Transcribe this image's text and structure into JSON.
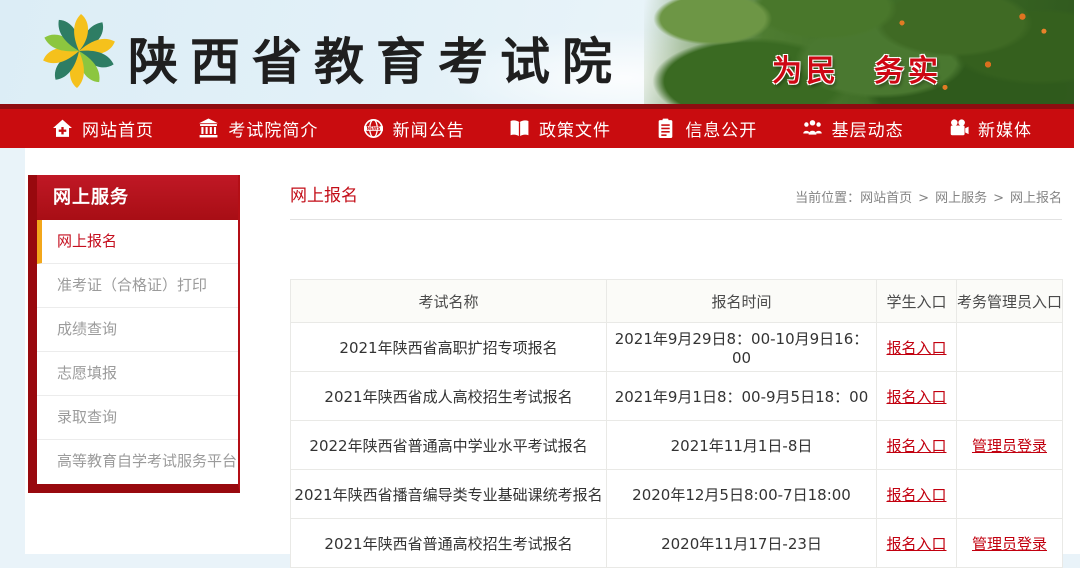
{
  "header": {
    "site_title": "陕西省教育考试院",
    "slogan": "为民　务实",
    "logo": "pinwheel-logo"
  },
  "nav": {
    "items": [
      {
        "label": "网站首页",
        "icon": "home-icon"
      },
      {
        "label": "考试院简介",
        "icon": "building-icon"
      },
      {
        "label": "新闻公告",
        "icon": "news-globe-icon"
      },
      {
        "label": "政策文件",
        "icon": "open-book-icon"
      },
      {
        "label": "信息公开",
        "icon": "document-icon"
      },
      {
        "label": "基层动态",
        "icon": "people-icon"
      },
      {
        "label": "新媒体",
        "icon": "video-camera-icon"
      }
    ]
  },
  "sidebar": {
    "title": "网上服务",
    "items": [
      {
        "label": "网上报名",
        "active": true
      },
      {
        "label": "准考证（合格证）打印",
        "active": false
      },
      {
        "label": "成绩查询",
        "active": false
      },
      {
        "label": "志愿填报",
        "active": false
      },
      {
        "label": "录取查询",
        "active": false
      },
      {
        "label": "高等教育自学考试服务平台",
        "active": false
      }
    ]
  },
  "main": {
    "page_title": "网上报名",
    "breadcrumb": {
      "prefix": "当前位置：",
      "separator": ">",
      "items": [
        "网站首页",
        "网上服务",
        "网上报名"
      ]
    },
    "table": {
      "columns": [
        "考试名称",
        "报名时间",
        "学生入口",
        "考务管理员入口"
      ],
      "rows": [
        {
          "exam": "2021年陕西省高职扩招专项报名",
          "time": "2021年9月29日8：00-10月9日16：00",
          "student_link": "报名入口",
          "admin_link": ""
        },
        {
          "exam": "2021年陕西省成人高校招生考试报名",
          "time": "2021年9月1日8：00-9月5日18：00",
          "student_link": "报名入口",
          "admin_link": ""
        },
        {
          "exam": "2022年陕西省普通高中学业水平考试报名",
          "time": "2021年11月1日-8日",
          "student_link": "报名入口",
          "admin_link": "管理员登录"
        },
        {
          "exam": "2021年陕西省播音编导类专业基础课统考报名",
          "time": "2020年12月5日8:00-7日18:00",
          "student_link": "报名入口",
          "admin_link": ""
        },
        {
          "exam": "2021年陕西省普通高校招生考试报名",
          "time": "2020年11月17日-23日",
          "student_link": "报名入口",
          "admin_link": "管理员登录"
        }
      ]
    }
  },
  "colors": {
    "nav_red": "#c90c0f",
    "dark_red": "#8e0c10",
    "link_red": "#c2000f",
    "active_bar_orange": "#f3a71b",
    "slogan_red": "#ce0713",
    "logo_teal": "#2e7d64",
    "logo_yellow": "#f5c11c",
    "logo_green": "#8cc63f"
  }
}
